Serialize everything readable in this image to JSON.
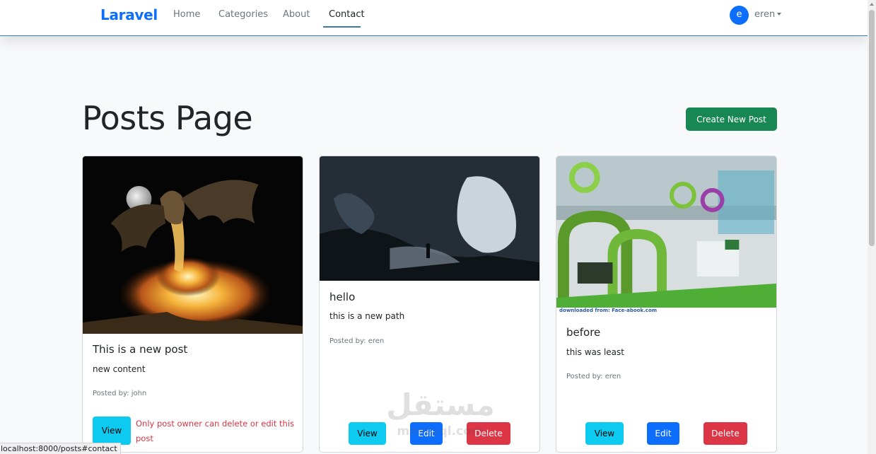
{
  "navbar": {
    "brand": "Laravel",
    "links": [
      {
        "label": "Home",
        "active": false
      },
      {
        "label": "Categories",
        "active": false
      },
      {
        "label": "About",
        "active": false
      },
      {
        "label": "Contact",
        "active": true
      }
    ],
    "user": {
      "initial": "e",
      "name": "eren"
    }
  },
  "page": {
    "title": "Posts Page",
    "create_button": "Create New Post"
  },
  "posts": [
    {
      "title": "This is a new post",
      "content": "new content",
      "posted_by": "Posted by: john",
      "view_label": "View",
      "owner_note": "Only post owner can delete or edit this post",
      "image": "dragon-breathing-fire-image"
    },
    {
      "title": "hello",
      "content": "this is a new path",
      "posted_by": "Posted by: eren",
      "view_label": "View",
      "edit_label": "Edit",
      "delete_label": "Delete",
      "image": "dark-cave-image"
    },
    {
      "title": "before",
      "content": "this was least",
      "posted_by": "Posted by: eren",
      "view_label": "View",
      "edit_label": "Edit",
      "delete_label": "Delete",
      "image": "office-interior-image",
      "image_caption": "downloaded from: Face-abook.com"
    }
  ],
  "watermark": {
    "arabic": "مستقل",
    "latin": "mostaql.com"
  },
  "status_bar": {
    "url": "localhost:8000/posts#contact"
  },
  "colors": {
    "primary": "#0d6efd",
    "success": "#198754",
    "info": "#0dcaf0",
    "danger": "#dc3545",
    "nav_accent": "#3a7ca5"
  }
}
